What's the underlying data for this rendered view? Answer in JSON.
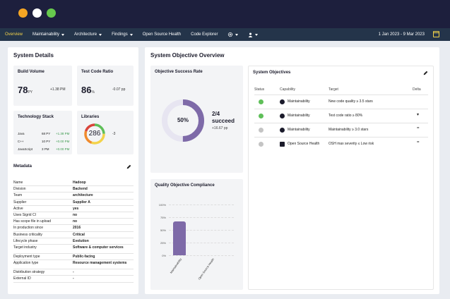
{
  "nav": {
    "items": [
      {
        "label": "Overview",
        "active": true,
        "has_caret": false
      },
      {
        "label": "Maintainability",
        "has_caret": true
      },
      {
        "label": "Architecture",
        "has_caret": true
      },
      {
        "label": "Findings",
        "has_caret": true
      },
      {
        "label": "Open Source Health",
        "has_caret": false
      },
      {
        "label": "Code Explorer",
        "has_caret": false
      }
    ],
    "date_range": "1 Jan 2023 - 9 Mar 2023"
  },
  "system_details": {
    "title": "System Details",
    "build_volume": {
      "title": "Build Volume",
      "value": "78",
      "unit": "PY",
      "delta": "+1.38 PM"
    },
    "test_code_ratio": {
      "title": "Test Code Ratio",
      "value": "86",
      "unit": "%",
      "delta": "-0.07 pp"
    },
    "technology_stack": {
      "title": "Technology Stack",
      "rows": [
        {
          "name": "Java",
          "py": "68 PY",
          "delta": "+1.38 PM"
        },
        {
          "name": "C++",
          "py": "10 PY",
          "delta": "+0.00 PM"
        },
        {
          "name": "JavaScript",
          "py": "3 PM",
          "delta": "+0.00 PM"
        }
      ]
    },
    "libraries": {
      "title": "Libraries",
      "value": "286",
      "delta": "-3"
    },
    "metadata": {
      "title": "Metadata",
      "rows": [
        {
          "k": "Name",
          "v": "Hadoop"
        },
        {
          "k": "Division",
          "v": "Backend"
        },
        {
          "k": "Team",
          "v": "architecture"
        },
        {
          "k": "Supplier",
          "v": "Supplier A"
        },
        {
          "k": "Active",
          "v": "yes"
        },
        {
          "k": "Uses Sigrid CI",
          "v": "no"
        },
        {
          "k": "Has scope file in upload",
          "v": "no"
        },
        {
          "k": "In production since",
          "v": "2016"
        },
        {
          "k": "Business criticality",
          "v": "Critical"
        },
        {
          "k": "Lifecycle phase",
          "v": "Evolution"
        },
        {
          "k": "Target industry",
          "v": "Software & computer services"
        },
        {
          "k": "Deployment type",
          "v": "Public-facing"
        },
        {
          "k": "Application type",
          "v": "Resource management systems"
        },
        {
          "k": "Distribution strategy",
          "v": "-"
        },
        {
          "k": "External ID",
          "v": "-"
        }
      ]
    }
  },
  "system_objective_overview": {
    "title": "System Objective Overview",
    "success_rate": {
      "title": "Objective Success Rate",
      "percent_label": "50%",
      "fraction": 0.5,
      "count": "2/4",
      "count_label": "succeed",
      "delta": "+16.67 pp"
    },
    "compliance": {
      "title": "Quality Objective Compliance"
    },
    "objectives": {
      "title": "System Objectives",
      "headers": {
        "status": "Status",
        "capability": "Capability",
        "target": "Target",
        "delta": "Delta"
      },
      "rows": [
        {
          "status": "ok",
          "capability": "Maintainability",
          "cap_icon": "maintainability-icon",
          "target": "New code quality ≥ 3.5 stars",
          "delta": ""
        },
        {
          "status": "ok",
          "capability": "Maintainability",
          "cap_icon": "maintainability-icon",
          "target": "Test code ratio ≥ 80%",
          "delta": "▾"
        },
        {
          "status": "na",
          "capability": "Maintainability",
          "cap_icon": "maintainability-icon",
          "target": "Maintainability ≥ 3.0 stars",
          "delta": "="
        },
        {
          "status": "na",
          "capability": "Open Source Health",
          "cap_icon": "open-source-health-icon",
          "target": "OSH max severity ≤ Low risk",
          "delta": "="
        }
      ]
    }
  },
  "chart_data": {
    "type": "bar",
    "title": "Quality Objective Compliance",
    "categories": [
      "Maintainability",
      "Open Source Health"
    ],
    "values": [
      67,
      0
    ],
    "ylim": [
      0,
      100
    ],
    "yticks": [
      "100%",
      "75%",
      "50%",
      "25%",
      "0%"
    ],
    "grid": true,
    "bar_color": "#7e6aa8"
  },
  "colors": {
    "accent": "#f3d34a",
    "nav_bg": "#24344a",
    "donut": "#7e6aa8",
    "donut_track": "#e7e5f1",
    "success": "#5fbf59"
  }
}
